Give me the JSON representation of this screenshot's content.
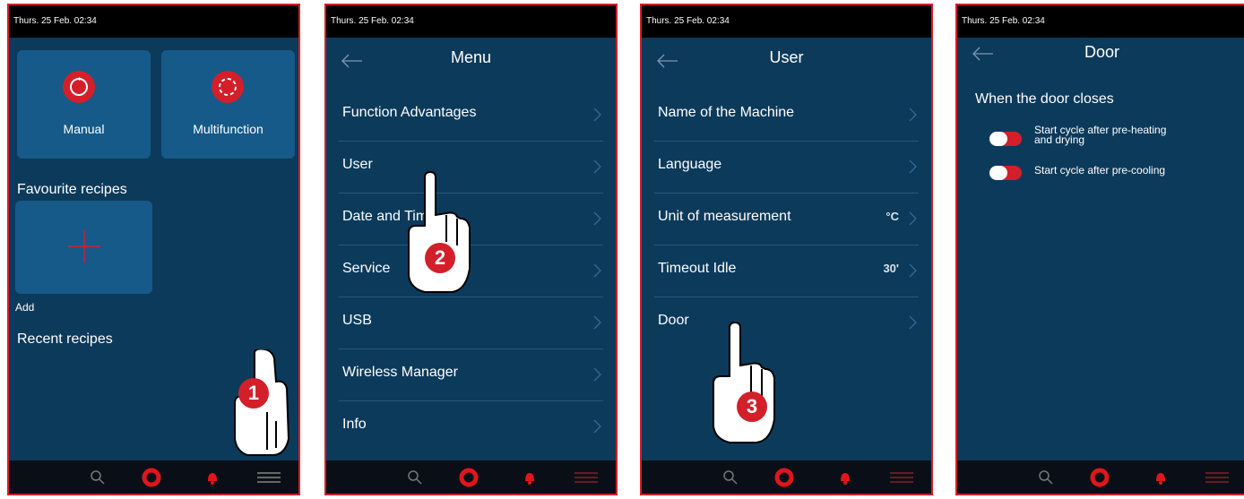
{
  "status_time": "Thurs. 25 Feb. 02:34",
  "screen1": {
    "tiles": [
      {
        "label": "Manual",
        "icon": "manual-cycle-icon"
      },
      {
        "label": "Multifunction",
        "icon": "multifunction-cycle-icon"
      }
    ],
    "favourites_title": "Favourite recipes",
    "add_label": "Add",
    "recent_title": "Recent recipes",
    "step": "1"
  },
  "screen2": {
    "title": "Menu",
    "items": [
      {
        "label": "Function Advantages"
      },
      {
        "label": "User"
      },
      {
        "label": "Date and Time"
      },
      {
        "label": "Service"
      },
      {
        "label": "USB"
      },
      {
        "label": "Wireless Manager"
      },
      {
        "label": "Info"
      }
    ],
    "step": "2"
  },
  "screen3": {
    "title": "User",
    "items": [
      {
        "label": "Name of the Machine",
        "value": ""
      },
      {
        "label": "Language",
        "value": ""
      },
      {
        "label": "Unit of measurement",
        "value": "°C"
      },
      {
        "label": "Timeout Idle",
        "value": "30'"
      },
      {
        "label": "Door",
        "value": ""
      }
    ],
    "step": "3"
  },
  "screen4": {
    "title": "Door",
    "section_title": "When the door closes",
    "options": [
      {
        "label_line1": "Start cycle after pre-heating",
        "label_line2": "and drying",
        "enabled": true
      },
      {
        "label_line1": "Start cycle after pre-cooling",
        "label_line2": "",
        "enabled": true
      }
    ]
  },
  "colors": {
    "screen_bg": "#0c3a5b",
    "tile_bg": "#155a88",
    "accent_red": "#d31f2a",
    "status_bar": "#000000",
    "bottom_bar": "#0a0f17"
  },
  "icons": {
    "back": "back-arrow-icon",
    "chevron": "chevron-right-icon",
    "search": "search-icon",
    "home": "home-ring-icon",
    "bell": "bell-icon",
    "menu": "hamburger-menu-icon",
    "add": "plus-icon"
  }
}
